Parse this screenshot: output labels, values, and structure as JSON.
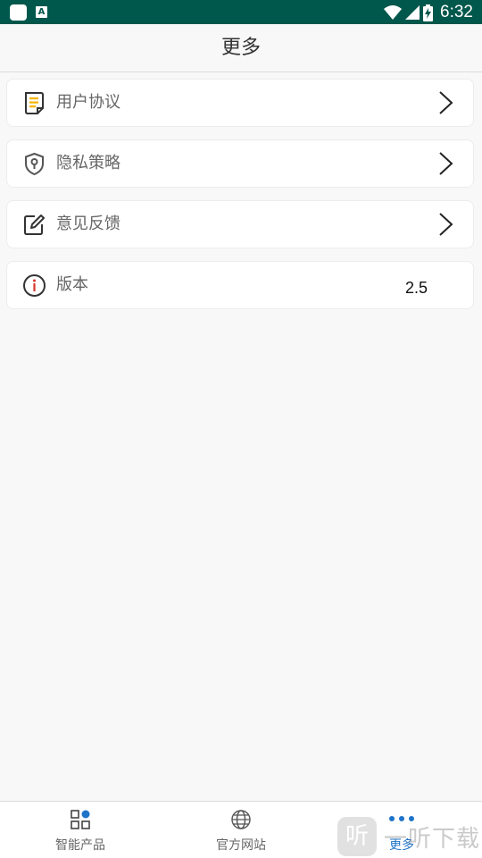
{
  "status_bar": {
    "time": "6:32",
    "notification_icons": [
      "app-square-icon",
      "font-a-icon"
    ],
    "system_icons": [
      "wifi-icon",
      "cell-signal-icon",
      "battery-charging-icon"
    ],
    "background_color": "#00574b"
  },
  "header": {
    "title": "更多"
  },
  "menu": {
    "items": [
      {
        "label": "用户协议",
        "icon": "document-icon",
        "has_chevron": true
      },
      {
        "label": "隐私策略",
        "icon": "shield-keyhole-icon",
        "has_chevron": true
      },
      {
        "label": "意见反馈",
        "icon": "edit-pencil-icon",
        "has_chevron": true
      },
      {
        "label": "版本",
        "icon": "info-circle-icon",
        "value": "2.5",
        "has_chevron": false
      }
    ]
  },
  "tab_bar": {
    "tabs": [
      {
        "label": "智能产品",
        "icon": "grid-apps-icon",
        "active": false
      },
      {
        "label": "官方网站",
        "icon": "globe-icon",
        "active": false
      },
      {
        "label": "更多",
        "icon": "more-dots-icon",
        "active": true
      }
    ],
    "active_color": "#1e74c9"
  },
  "watermark": {
    "badge": "听",
    "text": "一听下载"
  },
  "colors": {
    "accent_yellow": "#f5b400",
    "info_red": "#d9342b",
    "page_background": "#f8f8f8"
  }
}
